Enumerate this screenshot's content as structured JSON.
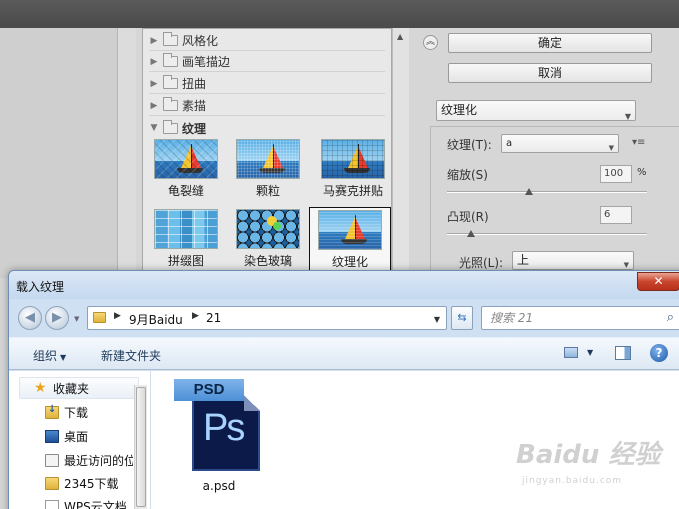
{
  "filter_gallery": {
    "categories": [
      {
        "label": "风格化",
        "expanded": false
      },
      {
        "label": "画笔描边",
        "expanded": false
      },
      {
        "label": "扭曲",
        "expanded": false
      },
      {
        "label": "素描",
        "expanded": false
      },
      {
        "label": "纹理",
        "expanded": true
      }
    ],
    "thumbnails": [
      {
        "label": "龟裂缝",
        "selected": false
      },
      {
        "label": "颗粒",
        "selected": false
      },
      {
        "label": "马赛克拼贴",
        "selected": false
      },
      {
        "label": "拼缀图",
        "selected": false
      },
      {
        "label": "染色玻璃",
        "selected": false
      },
      {
        "label": "纹理化",
        "selected": true
      }
    ],
    "ok_label": "确定",
    "cancel_label": "取消",
    "filter_select_value": "纹理化",
    "texture_label": "纹理(T):",
    "texture_value": "a",
    "scaling_label": "缩放(S)",
    "scaling_value": "100",
    "scaling_unit": "%",
    "scaling_level": 0.41,
    "relief_label": "凸现(R)",
    "relief_value": "6",
    "relief_level": 0.12,
    "light_label": "光照(L):",
    "light_value": "上"
  },
  "dialog": {
    "title": "载入纹理",
    "close_label": "✕",
    "breadcrumbs": [
      "9月Baidu",
      "21"
    ],
    "search_placeholder": "搜索 21",
    "toolbar": {
      "organize_label": "组织",
      "new_folder_label": "新建文件夹"
    },
    "nav_items": [
      {
        "label": "收藏夹",
        "icon": "star-icon"
      },
      {
        "label": "下载",
        "icon": "download-folder-icon"
      },
      {
        "label": "桌面",
        "icon": "desktop-icon"
      },
      {
        "label": "最近访问的位置",
        "icon": "recent-places-icon"
      },
      {
        "label": "2345下载",
        "icon": "folder-icon"
      },
      {
        "label": "WPS云文档",
        "icon": "document-icon"
      }
    ],
    "files": [
      {
        "name": "a.psd",
        "icon": "psd-file-icon",
        "icon_text": "PSD",
        "icon_logo": "Ps"
      }
    ]
  },
  "watermark": {
    "main_text": "Baidu 经验",
    "sub_text": "jingyan.baidu.com"
  },
  "colors": {
    "dialog_frame": "#cfe0f2",
    "close_button": "#c9452d",
    "psd_blue": "#4d8fd6",
    "psd_dark": "#0c1a4a"
  }
}
